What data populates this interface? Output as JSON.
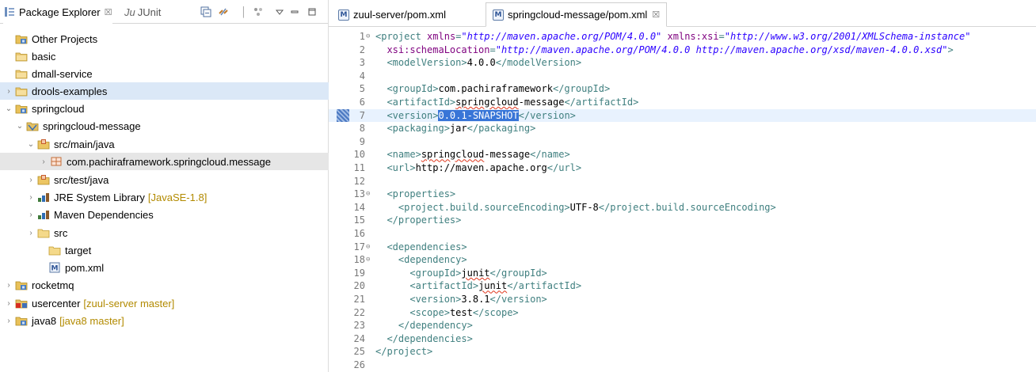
{
  "left_panel": {
    "tabs": {
      "package_explorer": "Package Explorer",
      "package_explorer_close": "☒",
      "junit": "JUnit",
      "junit_prefix": "Ju"
    },
    "tree": [
      {
        "label": "Other Projects",
        "icon": "working-set-icon"
      },
      {
        "label": "basic",
        "icon": "project-icon"
      },
      {
        "label": "dmall-service",
        "icon": "project-icon"
      },
      {
        "label": "drools-examples",
        "icon": "project-icon"
      },
      {
        "label": "springcloud",
        "icon": "working-set-icon"
      },
      {
        "label": "springcloud-message",
        "icon": "maven-project-icon"
      },
      {
        "label": "src/main/java",
        "icon": "source-folder-icon"
      },
      {
        "label": "com.pachiraframework.springcloud.message",
        "icon": "package-icon"
      },
      {
        "label": "src/test/java",
        "icon": "source-folder-icon"
      },
      {
        "label": "JRE System Library",
        "decoration": "[JavaSE-1.8]",
        "icon": "library-icon"
      },
      {
        "label": "Maven Dependencies",
        "icon": "library-icon"
      },
      {
        "label": "src",
        "icon": "folder-icon"
      },
      {
        "label": "target",
        "icon": "folder-icon"
      },
      {
        "label": "pom.xml",
        "icon": "maven-file-icon"
      },
      {
        "label": "rocketmq",
        "icon": "working-set-icon"
      },
      {
        "label": "usercenter",
        "decoration": "[zuul-server master]",
        "icon": "git-project-icon"
      },
      {
        "label": "java8",
        "decoration": "[java8 master]",
        "icon": "working-set-icon"
      }
    ]
  },
  "editor": {
    "tabs": [
      {
        "label": "zuul-server/pom.xml"
      },
      {
        "label": "springcloud-message/pom.xml",
        "close": "☒"
      }
    ],
    "file_icon_glyph": "M",
    "lines": [
      {
        "n": "1",
        "fold": "⊖",
        "segs": [
          [
            "t",
            "<"
          ],
          [
            "t",
            "project"
          ],
          [
            "p",
            " "
          ],
          [
            "a",
            "xmlns"
          ],
          [
            "t",
            "="
          ],
          [
            "v",
            "\"http://maven.apache.org/POM/4.0.0\""
          ],
          [
            "p",
            " "
          ],
          [
            "a",
            "xmlns:xsi"
          ],
          [
            "t",
            "="
          ],
          [
            "v",
            "\"http://www.w3.org/2001/XMLSchema-instance\""
          ]
        ]
      },
      {
        "n": "2",
        "segs": [
          [
            "p",
            "  "
          ],
          [
            "a",
            "xsi:schemaLocation"
          ],
          [
            "t",
            "="
          ],
          [
            "v",
            "\"http://maven.apache.org/POM/4.0.0 http://maven.apache.org/xsd/maven-4.0.0.xsd\""
          ],
          [
            "t",
            ">"
          ]
        ]
      },
      {
        "n": "3",
        "segs": [
          [
            "p",
            "  "
          ],
          [
            "t",
            "<modelVersion>"
          ],
          [
            "p",
            "4.0.0"
          ],
          [
            "t",
            "</modelVersion>"
          ]
        ]
      },
      {
        "n": "4",
        "segs": []
      },
      {
        "n": "5",
        "segs": [
          [
            "p",
            "  "
          ],
          [
            "t",
            "<groupId>"
          ],
          [
            "p",
            "com.pachiraframework"
          ],
          [
            "t",
            "</groupId>"
          ]
        ]
      },
      {
        "n": "6",
        "segs": [
          [
            "p",
            "  "
          ],
          [
            "t",
            "<artifactId>"
          ],
          [
            "sq",
            "springcloud"
          ],
          [
            "p",
            "-message"
          ],
          [
            "t",
            "</artifactId>"
          ]
        ]
      },
      {
        "n": "7",
        "current": true,
        "segs": [
          [
            "p",
            "  "
          ],
          [
            "t",
            "<version>"
          ],
          [
            "hl",
            "0.0.1-SNAPSHOT"
          ],
          [
            "t",
            "</version>"
          ]
        ]
      },
      {
        "n": "8",
        "segs": [
          [
            "p",
            "  "
          ],
          [
            "t",
            "<packaging>"
          ],
          [
            "p",
            "jar"
          ],
          [
            "t",
            "</packaging>"
          ]
        ]
      },
      {
        "n": "9",
        "segs": []
      },
      {
        "n": "10",
        "segs": [
          [
            "p",
            "  "
          ],
          [
            "t",
            "<name>"
          ],
          [
            "sq",
            "springcloud"
          ],
          [
            "p",
            "-message"
          ],
          [
            "t",
            "</name>"
          ]
        ]
      },
      {
        "n": "11",
        "segs": [
          [
            "p",
            "  "
          ],
          [
            "t",
            "<url>"
          ],
          [
            "p",
            "http://maven.apache.org"
          ],
          [
            "t",
            "</url>"
          ]
        ]
      },
      {
        "n": "12",
        "segs": []
      },
      {
        "n": "13",
        "fold": "⊖",
        "segs": [
          [
            "p",
            "  "
          ],
          [
            "t",
            "<properties>"
          ]
        ]
      },
      {
        "n": "14",
        "segs": [
          [
            "p",
            "    "
          ],
          [
            "t",
            "<project.build.sourceEncoding>"
          ],
          [
            "p",
            "UTF-8"
          ],
          [
            "t",
            "</project.build.sourceEncoding>"
          ]
        ]
      },
      {
        "n": "15",
        "segs": [
          [
            "p",
            "  "
          ],
          [
            "t",
            "</properties>"
          ]
        ]
      },
      {
        "n": "16",
        "segs": []
      },
      {
        "n": "17",
        "fold": "⊖",
        "segs": [
          [
            "p",
            "  "
          ],
          [
            "t",
            "<dependencies>"
          ]
        ]
      },
      {
        "n": "18",
        "fold": "⊖",
        "segs": [
          [
            "p",
            "    "
          ],
          [
            "t",
            "<dependency>"
          ]
        ]
      },
      {
        "n": "19",
        "segs": [
          [
            "p",
            "      "
          ],
          [
            "t",
            "<groupId>"
          ],
          [
            "sq",
            "junit"
          ],
          [
            "t",
            "</groupId>"
          ]
        ]
      },
      {
        "n": "20",
        "segs": [
          [
            "p",
            "      "
          ],
          [
            "t",
            "<artifactId>"
          ],
          [
            "sq",
            "junit"
          ],
          [
            "t",
            "</artifactId>"
          ]
        ]
      },
      {
        "n": "21",
        "segs": [
          [
            "p",
            "      "
          ],
          [
            "t",
            "<version>"
          ],
          [
            "p",
            "3.8.1"
          ],
          [
            "t",
            "</version>"
          ]
        ]
      },
      {
        "n": "22",
        "segs": [
          [
            "p",
            "      "
          ],
          [
            "t",
            "<scope>"
          ],
          [
            "p",
            "test"
          ],
          [
            "t",
            "</scope>"
          ]
        ]
      },
      {
        "n": "23",
        "segs": [
          [
            "p",
            "    "
          ],
          [
            "t",
            "</dependency>"
          ]
        ]
      },
      {
        "n": "24",
        "segs": [
          [
            "p",
            "  "
          ],
          [
            "t",
            "</dependencies>"
          ]
        ]
      },
      {
        "n": "25",
        "segs": [
          [
            "t",
            "</project>"
          ]
        ]
      },
      {
        "n": "26",
        "segs": []
      }
    ]
  }
}
